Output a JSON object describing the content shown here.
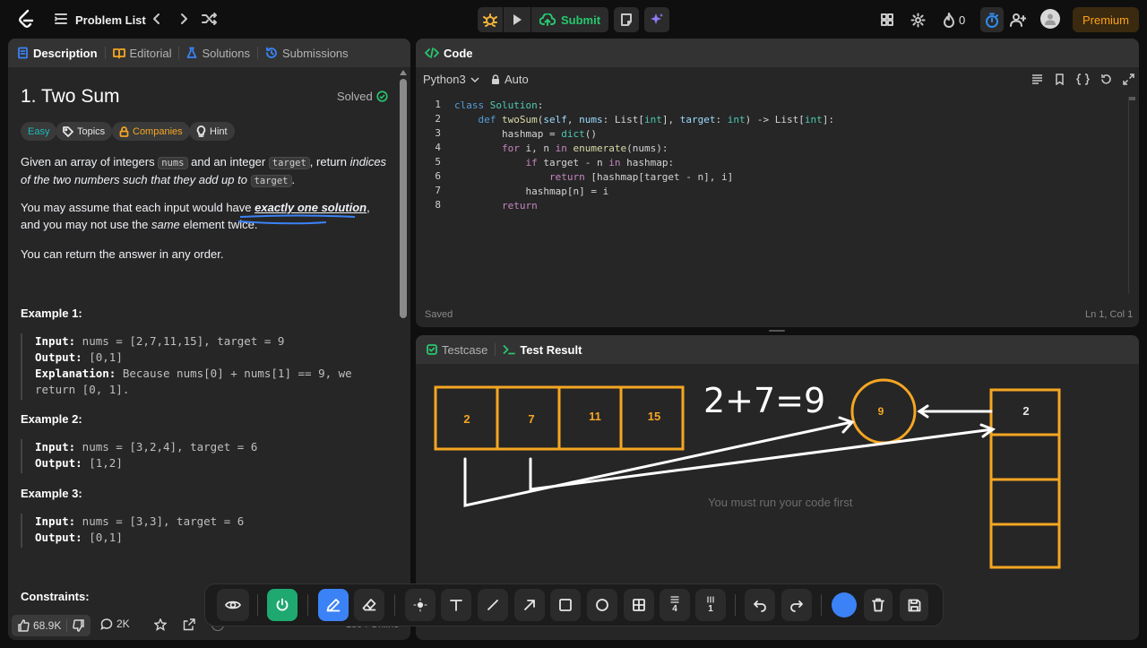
{
  "topbar": {
    "problem_list": "Problem List",
    "submit": "Submit",
    "streak": "0",
    "premium": "Premium"
  },
  "left": {
    "tabs": [
      "Description",
      "Editorial",
      "Solutions",
      "Submissions"
    ],
    "title": "1. Two Sum",
    "status": "Solved",
    "badges": [
      "Easy",
      "Topics",
      "Companies",
      "Hint"
    ],
    "p1": {
      "t1": "Given an array of integers ",
      "c1": "nums",
      "t2": " and an integer ",
      "c2": "target",
      "t3": ", return ",
      "i1": "indices of the two numbers such that they add up to",
      "t4": " ",
      "c3": "target",
      "t5": "."
    },
    "p2": {
      "t1": "You may assume that each input would have ",
      "b1": "exactly one solution",
      "t2": ", and you may not use the ",
      "i1": "same",
      "t3": " element twice."
    },
    "p3": "You can return the answer in any order.",
    "examples": [
      {
        "heading": "Example 1:",
        "input_label": "Input:",
        "input": " nums = [2,7,11,15], target = 9",
        "output_label": "Output:",
        "output": " [0,1]",
        "expl_label": "Explanation:",
        "expl": " Because nums[0] + nums[1] == 9, we return [0, 1]."
      },
      {
        "heading": "Example 2:",
        "input_label": "Input:",
        "input": " nums = [3,2,4], target = 6",
        "output_label": "Output:",
        "output": " [1,2]"
      },
      {
        "heading": "Example 3:",
        "input_label": "Input:",
        "input": " nums = [3,3], target = 6",
        "output_label": "Output:",
        "output": " [0,1]"
      }
    ],
    "constraints": "Constraints:",
    "likes": "68.9K",
    "comments": "2K",
    "online": "1394 Online"
  },
  "code": {
    "tab": "Code",
    "language": "Python3",
    "mode": "Auto",
    "status": "Saved",
    "cursor": "Ln 1, Col 1",
    "line_numbers": [
      "1",
      "2",
      "3",
      "4",
      "5",
      "6",
      "7",
      "8"
    ]
  },
  "result": {
    "tabs": [
      "Testcase",
      "Test Result"
    ],
    "placeholder": "You must run your code first"
  },
  "drawing": {
    "array": [
      "2",
      "7",
      "11",
      "15"
    ],
    "equation": "2+7=9",
    "circle": "9",
    "stack": [
      "2",
      "",
      "",
      ""
    ],
    "color_orange": "#f5a623",
    "color_white": "#ffffff"
  },
  "toolbar": {
    "row_count": "4",
    "col_count": "1",
    "accent": "#2f8cf0",
    "active_green": "#1fa971"
  }
}
